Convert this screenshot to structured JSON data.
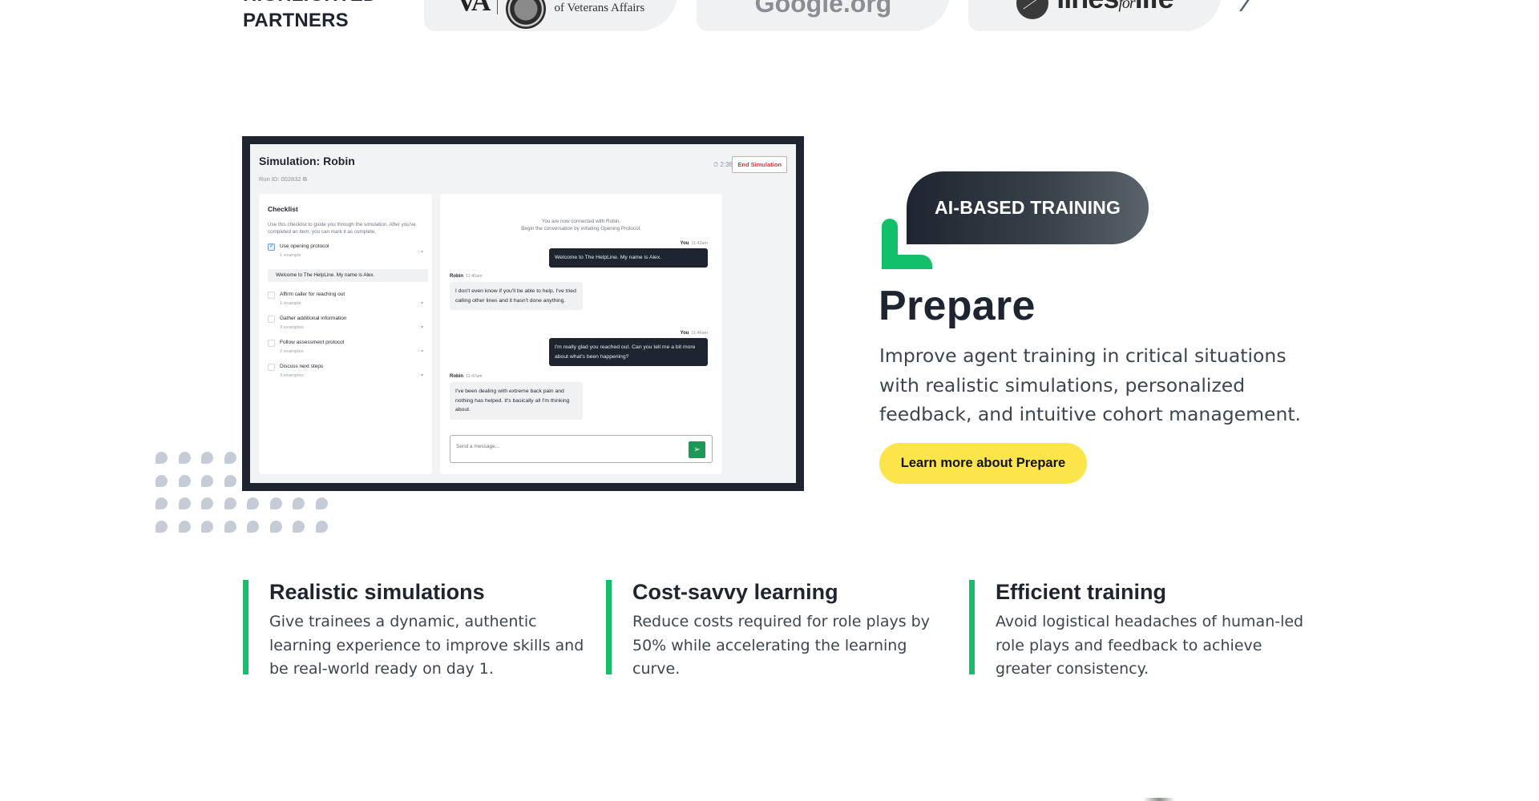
{
  "partners": {
    "heading_line1": "HIGHLIGHTED",
    "heading_line2": "PARTNERS",
    "logos": [
      {
        "name": "U.S. Department of Veterans Affairs",
        "mark": "VA",
        "text": "of Veterans Affairs"
      },
      {
        "name": "Google.org",
        "text": "Google.org"
      },
      {
        "name": "Lines for Life",
        "text_a": "lines",
        "text_b": "for",
        "text_c": "life"
      }
    ],
    "next_icon": "chevron-right-icon"
  },
  "simulation": {
    "title": "Simulation: Robin",
    "run_id": "Run ID: 002832",
    "timer": "2:36",
    "end_button": "End Simulation",
    "checklist": {
      "title": "Checklist",
      "description": "Use this checklist to guide you through the simulation. After you've completed an item, you can mark it as complete.",
      "items": [
        {
          "label": "Use opening protocol",
          "count": "1 example",
          "checked": true,
          "expanded": true,
          "example": "Welcome to The HelpLine. My name is Alex."
        },
        {
          "label": "Affirm caller for reaching out",
          "count": "1 example",
          "checked": false,
          "expanded": false
        },
        {
          "label": "Gather additional information",
          "count": "3 examples",
          "checked": false,
          "expanded": false
        },
        {
          "label": "Follow assessment protocol",
          "count": "2 examples",
          "checked": false,
          "expanded": false
        },
        {
          "label": "Discuss next steps",
          "count": "3 examples",
          "checked": false,
          "expanded": false
        }
      ]
    },
    "chat": {
      "system_line1": "You are now connected with Robin.",
      "system_line2": "Begin the conversation by initiating Opening Protocol.",
      "messages": [
        {
          "sender": "You",
          "time": "11:43am",
          "text": "Welcome to The HelpLine. My name is Alex."
        },
        {
          "sender": "Robin",
          "time": "11:45am",
          "text": "I don't even know if you'll be able to help, I've tried calling other lines and it hasn't done anything."
        },
        {
          "sender": "You",
          "time": "11:46am",
          "text": "I'm really glad you reached out. Can you tell me a bit more about what's been happening?"
        },
        {
          "sender": "Robin",
          "time": "11:47am",
          "text": "I've been dealing with extreme back pain and nothing has helped. It's basically all I'm thinking about."
        }
      ],
      "input_placeholder": "Send a message..."
    }
  },
  "product": {
    "tag": "AI-BASED TRAINING",
    "title": "Prepare",
    "description": "Improve agent training in critical situations with realistic simulations, personalized feedback, and intuitive cohort management.",
    "cta": "Learn more about Prepare"
  },
  "features": [
    {
      "title": "Realistic simulations",
      "text": "Give trainees a dynamic, authentic learning experience to improve skills and be real-world ready on day 1."
    },
    {
      "title": "Cost-savvy learning",
      "text": "Reduce costs required for role plays by 50% while accelerating the learning curve."
    },
    {
      "title": "Efficient training",
      "text": "Avoid logistical headaches of human-led role plays and feedback to achieve greater consistency."
    }
  ],
  "colors": {
    "brand_dark": "#1e2530",
    "accent_green": "#12c06a",
    "cta_yellow": "#fce54a",
    "end_sim_red": "#d23a3a",
    "send_green": "#1a9a56"
  }
}
